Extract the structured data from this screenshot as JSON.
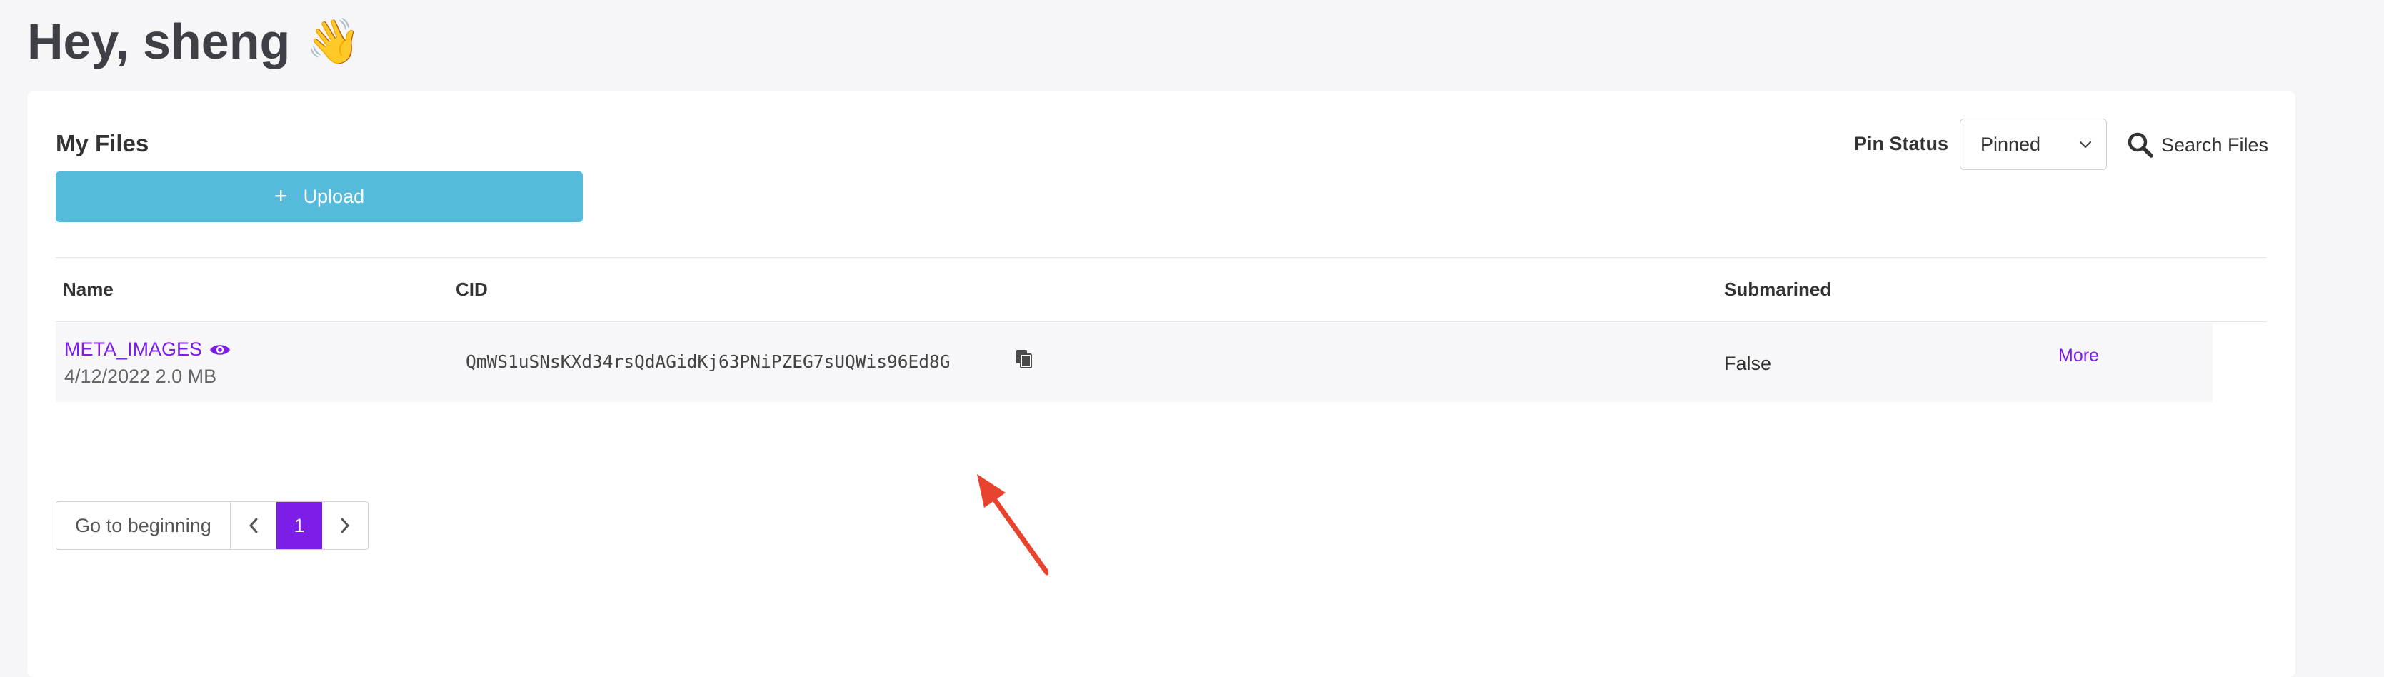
{
  "header": {
    "greeting": "Hey, sheng",
    "greeting_emoji": "👋"
  },
  "files_card": {
    "title": "My Files",
    "upload_label": "Upload",
    "pin_status": {
      "label": "Pin Status",
      "selected": "Pinned"
    },
    "search_label": "Search Files"
  },
  "table": {
    "columns": {
      "name": "Name",
      "cid": "CID",
      "submarined": "Submarined"
    },
    "rows": [
      {
        "name": "META_IMAGES",
        "meta": "4/12/2022 2.0 MB",
        "cid": "QmWS1uSNsKXd34rsQdAGidKj63PNiPZEG7sUQWis96Ed8G",
        "submarined": "False",
        "more": "More"
      }
    ]
  },
  "pagination": {
    "begin_label": "Go to beginning",
    "current_page": "1"
  },
  "colors": {
    "accent": "#7c1ee8",
    "upload_button": "#56bbdb",
    "annotation_arrow": "#e8432e",
    "background": "#f6f6f9"
  },
  "icons": {
    "wave": "waving-hand-emoji",
    "visibility": "eye-icon",
    "copy": "copy-icon",
    "search": "search-icon",
    "dropdown": "chevron-down-icon",
    "prev": "chevron-left-icon",
    "next": "chevron-right-icon",
    "add": "plus-icon"
  }
}
